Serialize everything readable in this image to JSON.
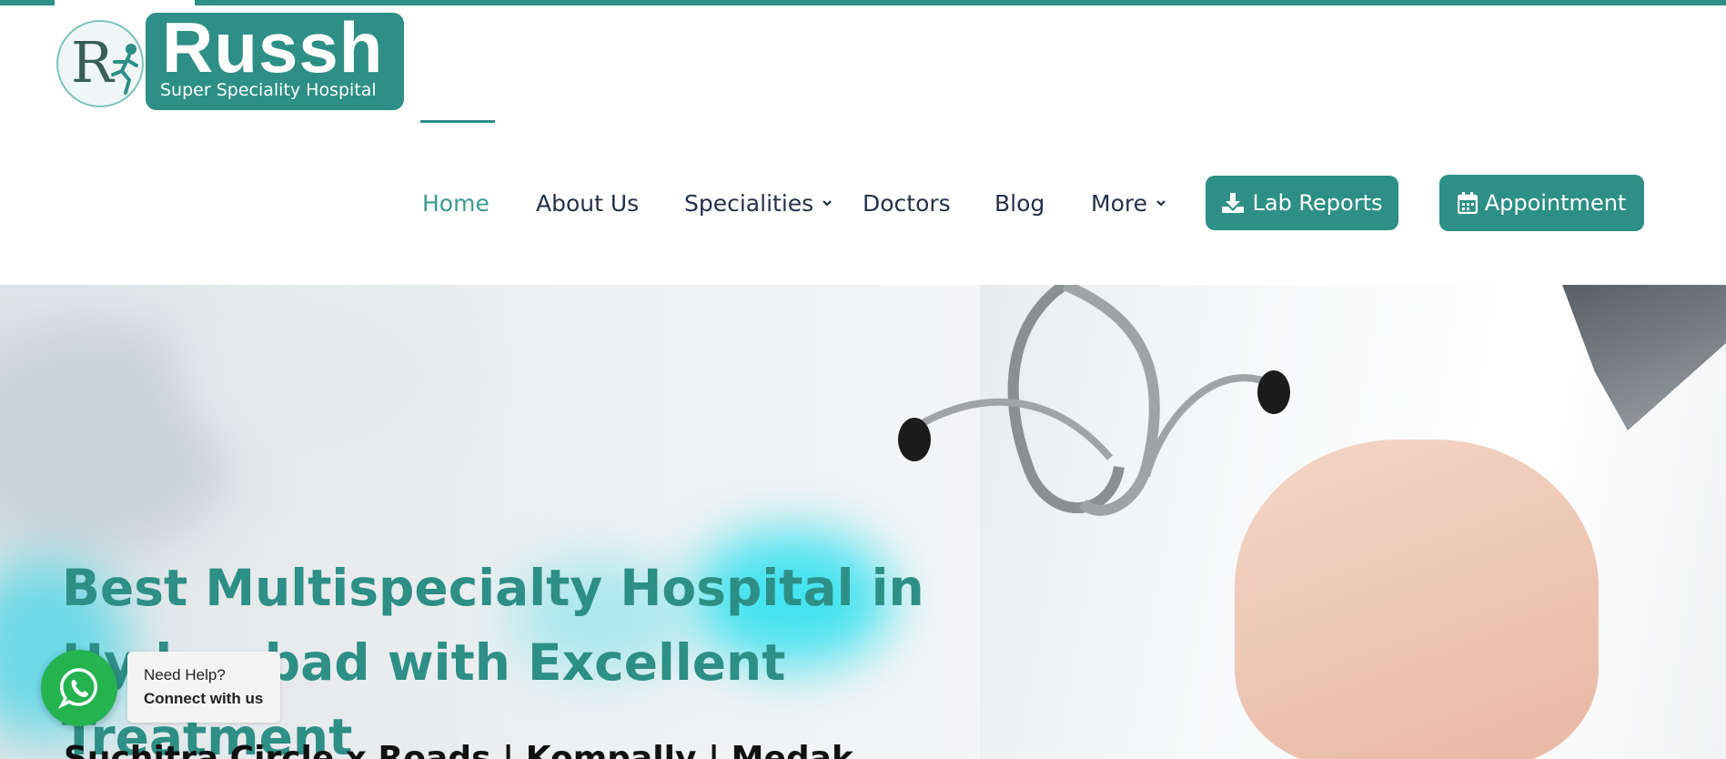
{
  "header": {
    "logo_name": "Russh",
    "logo_tagline": "Super Speciality Hospital",
    "logo_letter": "R"
  },
  "nav": {
    "items": [
      {
        "label": "Home",
        "active": true
      },
      {
        "label": "About Us"
      },
      {
        "label": "Specialities",
        "has_dropdown": true
      },
      {
        "label": "Doctors"
      },
      {
        "label": "Blog"
      },
      {
        "label": "More",
        "has_dropdown": true
      }
    ],
    "lab_reports": "Lab Reports",
    "appointment": "Appointment"
  },
  "hero": {
    "title": "Best Multispecialty Hospital in Hyderabad with Excellent Treatment",
    "subtitle": "Suchitra Circle x Roads | Kompally | Medak"
  },
  "whatsapp": {
    "line1": "Need Help?",
    "line2": "Connect with us"
  },
  "colors": {
    "brand": "#2d8f86",
    "nav_text": "#24304a",
    "whatsapp": "#25b350"
  }
}
